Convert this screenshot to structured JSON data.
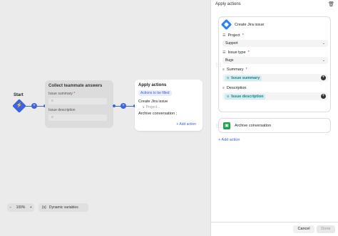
{
  "canvas": {
    "start_label": "Start",
    "collect_card": {
      "title": "Collect teammate answers",
      "summary_label": "Issue summary",
      "description_label": "Issue description",
      "required_mark": "*"
    },
    "apply_card": {
      "title": "Apply actions",
      "to_fill_badge": "Actions to be filled",
      "row1": "Create Jira issue",
      "row1_sub": "Project...",
      "row2": "Archive conversation ;",
      "add_action": "+ Add action"
    },
    "zoom": {
      "minus": "−",
      "level": "100%",
      "plus": "+"
    },
    "dynamic_variables": "Dynamic variables"
  },
  "panel": {
    "header": "Apply actions",
    "jira": {
      "title": "Create Jira issue",
      "project_label": "Project",
      "project_value": "Support",
      "issue_type_label": "Issue type",
      "issue_type_value": "Bugs",
      "summary_label": "Summary",
      "summary_value": "Issue summary",
      "description_label": "Description",
      "description_value": "Issue description",
      "required_mark": "*"
    },
    "archive": {
      "title": "Archive conversation"
    },
    "add_action": "+ Add action",
    "cancel": "Cancel",
    "done": "Done"
  },
  "colors": {
    "accent": "#3d63dd",
    "jira": "#2684ff",
    "archive": "#1aa34a",
    "variable": "#1a7f8f"
  }
}
